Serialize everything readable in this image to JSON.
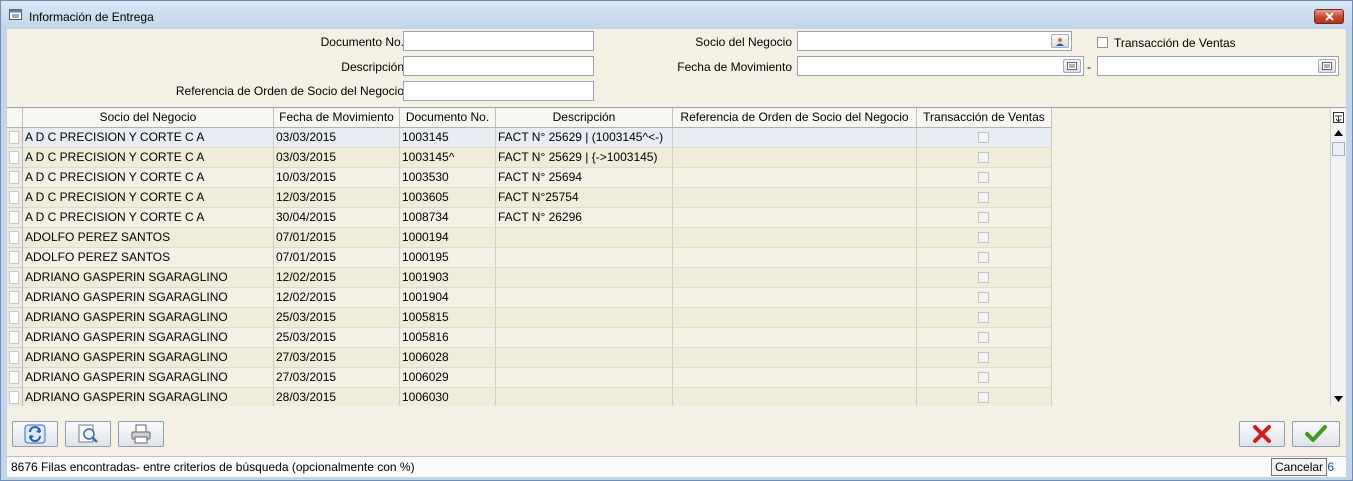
{
  "window": {
    "title": "Información de Entrega"
  },
  "search": {
    "documento_no_label": "Documento No.",
    "descripcion_label": "Descripción",
    "referencia_label": "Referencia de Orden de Socio del Negocio",
    "socio_label": "Socio del Negocio",
    "fecha_label": "Fecha de Movimiento",
    "fecha_separator": "-",
    "transaccion_label": "Transacción de Ventas",
    "documento_no_value": "",
    "descripcion_value": "",
    "referencia_value": "",
    "socio_value": "",
    "fecha_desde_value": "",
    "fecha_hasta_value": ""
  },
  "table": {
    "columns": [
      "Socio del Negocio",
      "Fecha de Movimiento",
      "Documento No.",
      "Descripción",
      "Referencia de Orden de Socio del Negocio",
      "Transacción de Ventas"
    ],
    "rows": [
      {
        "socio": "A D C  PRECISION Y CORTE  C A",
        "fecha": "03/03/2015",
        "doc": "1003145",
        "desc": "FACT N° 25629 | (1003145^<-)",
        "ref": ""
      },
      {
        "socio": "A D C  PRECISION Y CORTE  C A",
        "fecha": "03/03/2015",
        "doc": "1003145^",
        "desc": "FACT N° 25629 | {->1003145)",
        "ref": ""
      },
      {
        "socio": "A D C  PRECISION Y CORTE  C A",
        "fecha": "10/03/2015",
        "doc": "1003530",
        "desc": "FACT N° 25694",
        "ref": ""
      },
      {
        "socio": "A D C  PRECISION Y CORTE  C A",
        "fecha": "12/03/2015",
        "doc": "1003605",
        "desc": "FACT N°25754",
        "ref": ""
      },
      {
        "socio": "A D C  PRECISION Y CORTE  C A",
        "fecha": "30/04/2015",
        "doc": "1008734",
        "desc": "FACT N° 26296",
        "ref": ""
      },
      {
        "socio": "ADOLFO PEREZ SANTOS",
        "fecha": "07/01/2015",
        "doc": "1000194",
        "desc": "",
        "ref": ""
      },
      {
        "socio": "ADOLFO PEREZ SANTOS",
        "fecha": "07/01/2015",
        "doc": "1000195",
        "desc": "",
        "ref": ""
      },
      {
        "socio": "ADRIANO GASPERIN SGARAGLINO",
        "fecha": "12/02/2015",
        "doc": "1001903",
        "desc": "",
        "ref": ""
      },
      {
        "socio": "ADRIANO GASPERIN SGARAGLINO",
        "fecha": "12/02/2015",
        "doc": "1001904",
        "desc": "",
        "ref": ""
      },
      {
        "socio": "ADRIANO GASPERIN SGARAGLINO",
        "fecha": "25/03/2015",
        "doc": "1005815",
        "desc": "",
        "ref": ""
      },
      {
        "socio": "ADRIANO GASPERIN SGARAGLINO",
        "fecha": "25/03/2015",
        "doc": "1005816",
        "desc": "",
        "ref": ""
      },
      {
        "socio": "ADRIANO GASPERIN SGARAGLINO",
        "fecha": "27/03/2015",
        "doc": "1006028",
        "desc": "",
        "ref": ""
      },
      {
        "socio": "ADRIANO GASPERIN SGARAGLINO",
        "fecha": "27/03/2015",
        "doc": "1006029",
        "desc": "",
        "ref": ""
      },
      {
        "socio": "ADRIANO GASPERIN SGARAGLINO",
        "fecha": "28/03/2015",
        "doc": "1006030",
        "desc": "",
        "ref": ""
      }
    ]
  },
  "toolbar": {
    "refresh_icon": "refresh-icon",
    "zoom_icon": "zoom-icon",
    "print_icon": "print-icon",
    "cancel_icon": "red-x-icon",
    "ok_icon": "green-check-icon"
  },
  "status": {
    "text": "8676 Filas encontradas- entre criterios de búsqueda (opcionalmente con %)",
    "count": "76"
  },
  "tooltip": {
    "text": "Cancelar"
  },
  "colors": {
    "title_bar": "#c2d5ea",
    "panel": "#f4f1e4",
    "row_alt": "#efedd9",
    "selected_row": "#e8edf4",
    "close": "#c9442c"
  }
}
